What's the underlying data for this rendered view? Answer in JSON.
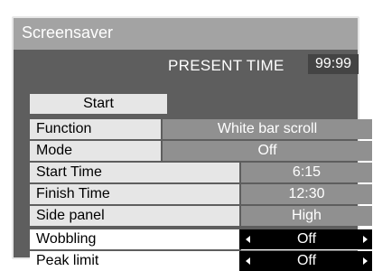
{
  "title": "Screensaver",
  "present_time": {
    "label": "PRESENT TIME",
    "value": "99:99"
  },
  "start_button": "Start",
  "rows": [
    {
      "label": "Function",
      "value": "White bar scroll"
    },
    {
      "label": "Mode",
      "value": "Off"
    },
    {
      "label": "Start Time",
      "value": "6:15"
    },
    {
      "label": "Finish Time",
      "value": "12:30"
    },
    {
      "label": "Side panel",
      "value": "High"
    },
    {
      "label": "Wobbling",
      "value": "Off"
    },
    {
      "label": "Peak limit",
      "value": "Off"
    }
  ],
  "colors": {
    "panel": "#5e5e5e",
    "title_bar": "#a3a3a3",
    "label_bg": "#e6e6e6",
    "value_bg": "#909090",
    "selected_value_bg": "#000000"
  },
  "icons": [
    "arrow-left-icon",
    "arrow-right-icon"
  ]
}
